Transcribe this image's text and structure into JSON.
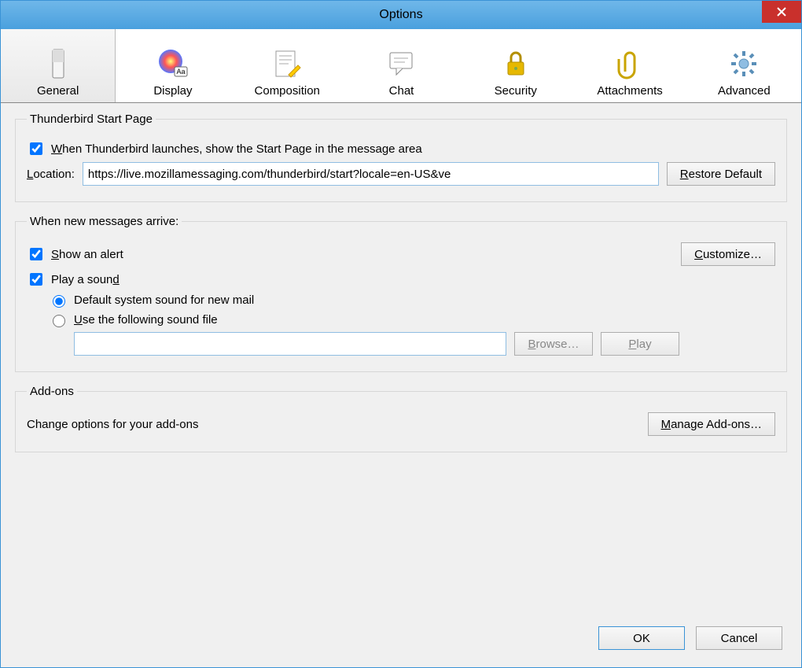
{
  "window": {
    "title": "Options"
  },
  "tabs": [
    {
      "label": "General"
    },
    {
      "label": "Display"
    },
    {
      "label": "Composition"
    },
    {
      "label": "Chat"
    },
    {
      "label": "Security"
    },
    {
      "label": "Attachments"
    },
    {
      "label": "Advanced"
    }
  ],
  "start_page": {
    "legend": "Thunderbird Start Page",
    "checkbox_pre": "W",
    "checkbox_rest": "hen Thunderbird launches, show the Start Page in the message area",
    "location_pre": "L",
    "location_rest": "ocation:",
    "location_value": "https://live.mozillamessaging.com/thunderbird/start?locale=en-US&ve",
    "restore_pre": "R",
    "restore_rest": "estore Default"
  },
  "new_messages": {
    "legend": "When new messages arrive:",
    "alert_pre": "S",
    "alert_rest": "how an alert",
    "customize_pre": "C",
    "customize_rest": "ustomize…",
    "sound_text": "Play a soun",
    "sound_post": "d",
    "radio_default": "Default system sound for new mail",
    "radio_file_pre": "U",
    "radio_file_rest": "se the following sound file",
    "soundfile_value": "",
    "browse_pre": "B",
    "browse_rest": "rowse…",
    "play_pre": "P",
    "play_rest": "lay"
  },
  "addons": {
    "legend": "Add-ons",
    "desc": "Change options for your add-ons",
    "manage_pre": "M",
    "manage_rest": "anage Add-ons…"
  },
  "footer": {
    "ok": "OK",
    "cancel": "Cancel"
  }
}
